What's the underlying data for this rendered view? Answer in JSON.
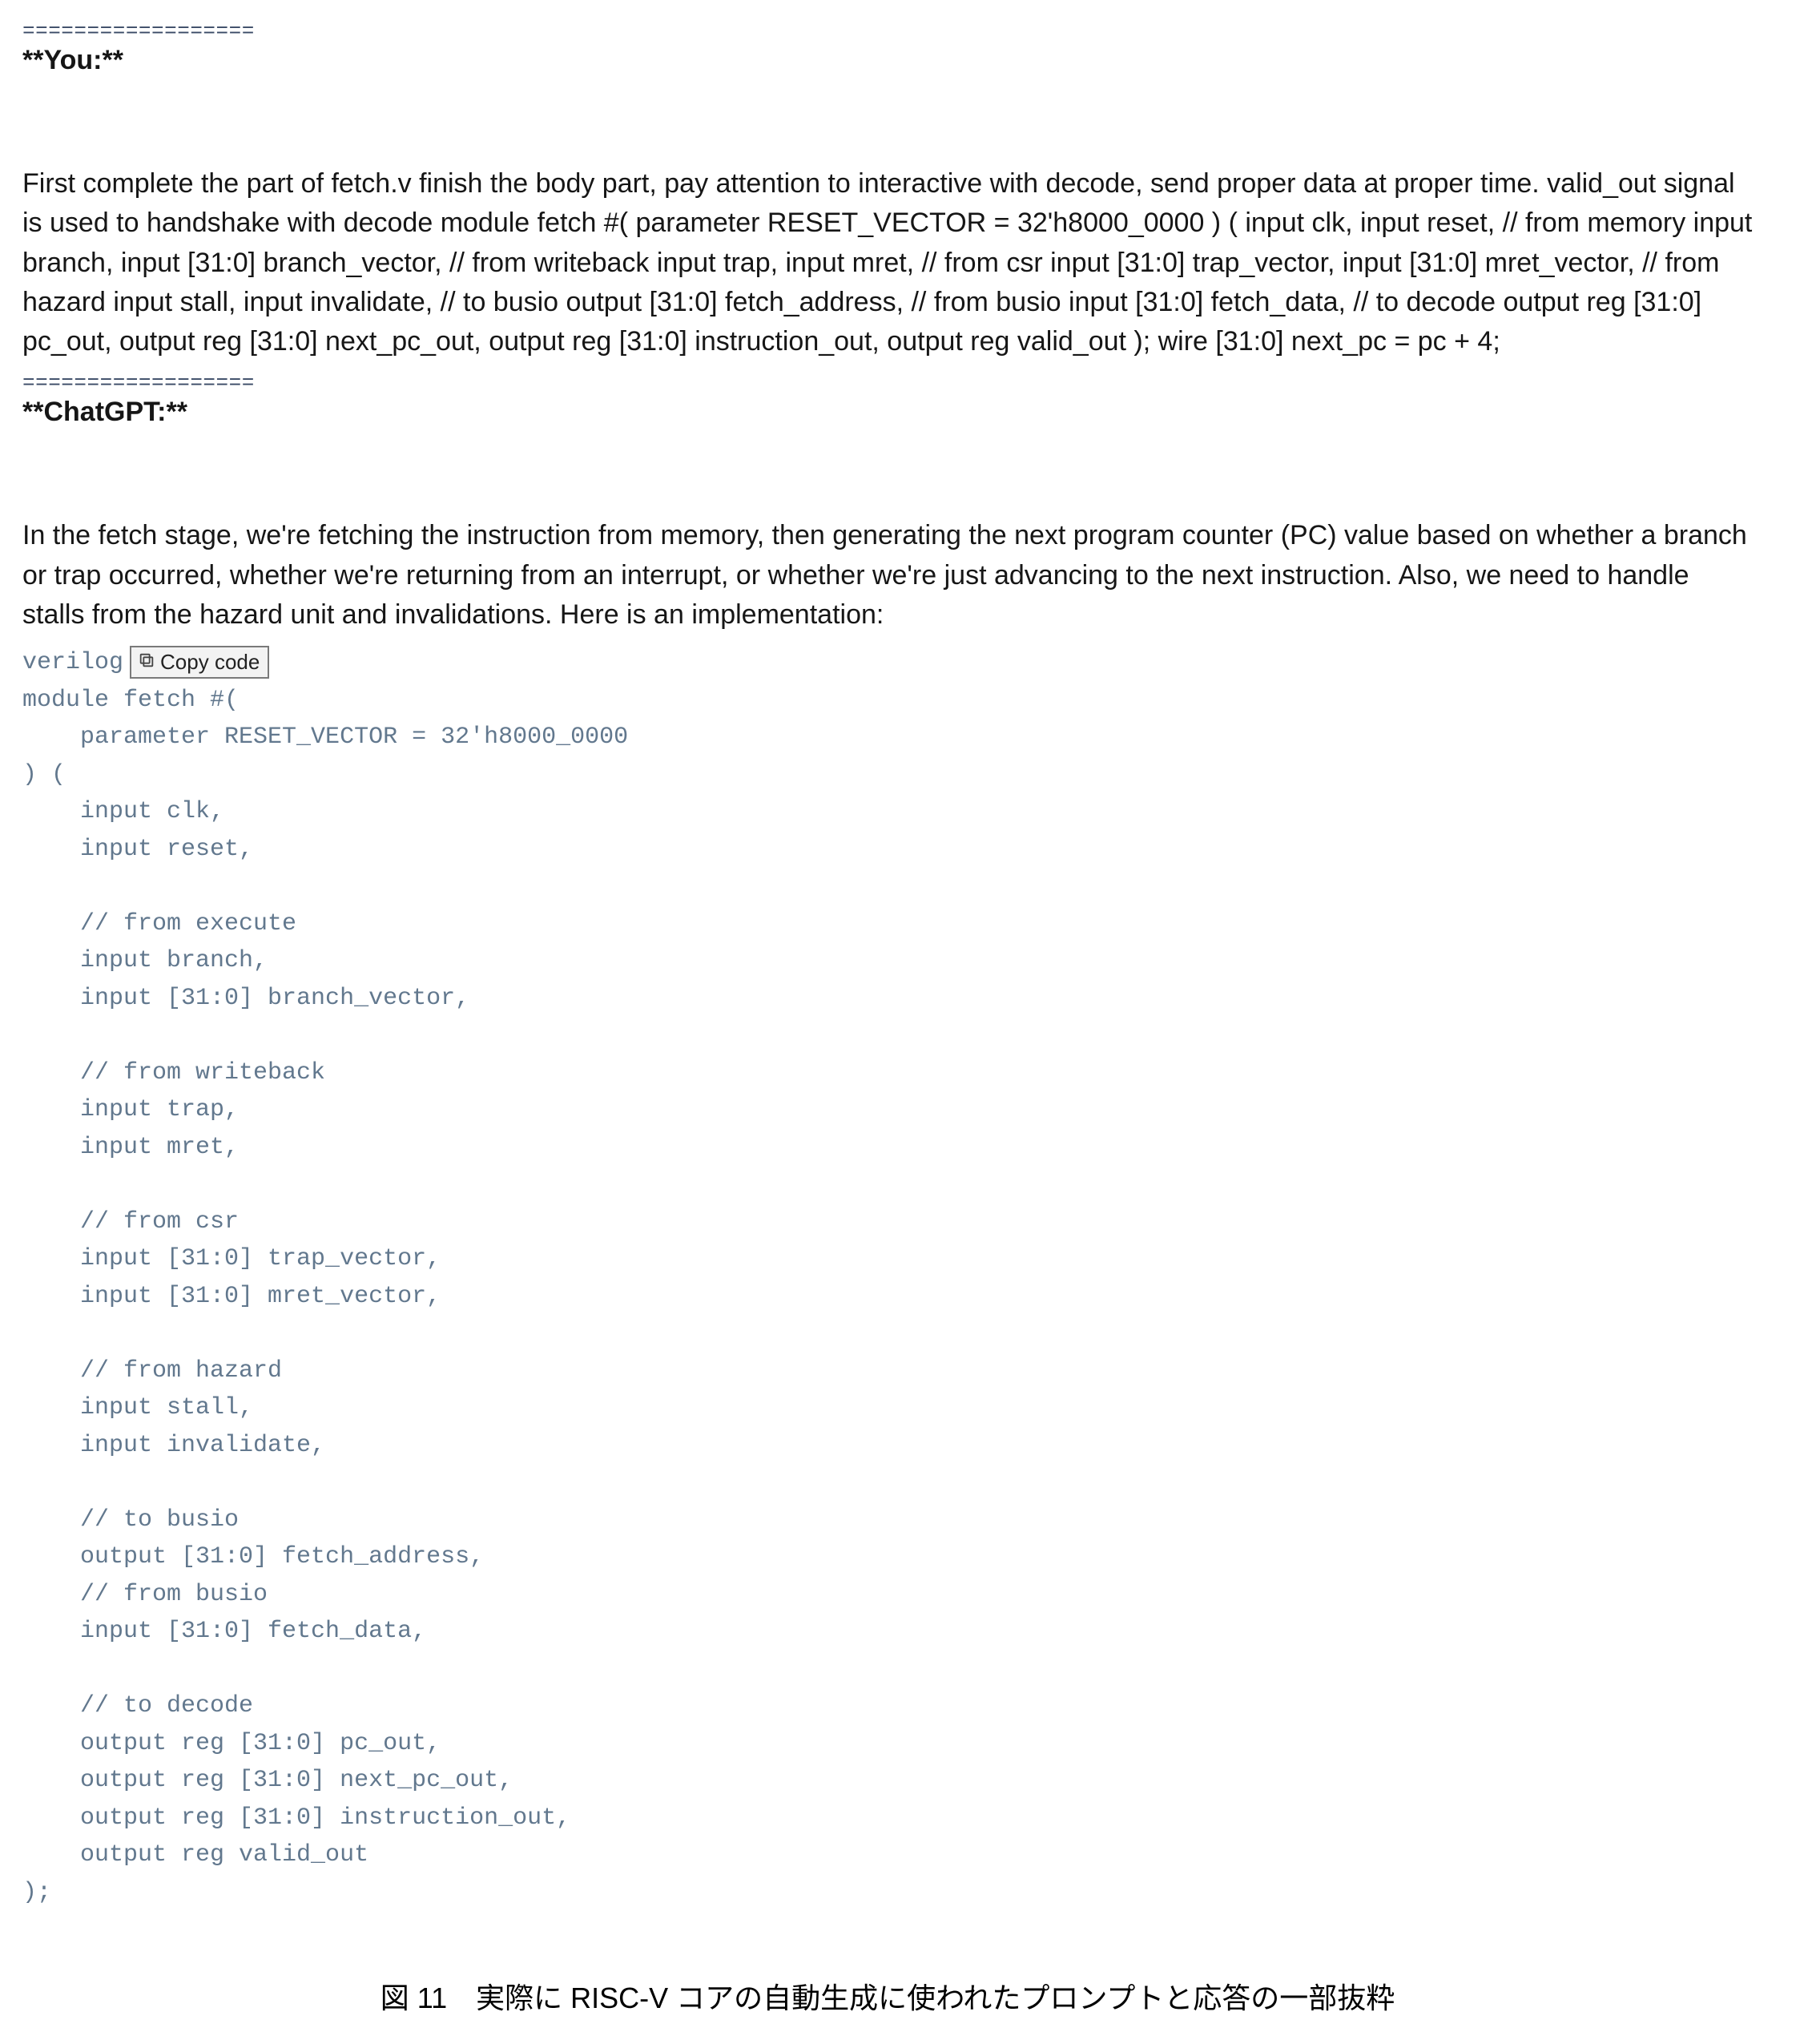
{
  "block1": {
    "separator": "==================",
    "speaker": "**You:**",
    "prose": "First complete the part of fetch.v finish the body part, pay attention to interactive with decode, send proper data at proper time. valid_out signal is used to handshake with decode module fetch #( parameter RESET_VECTOR = 32'h8000_0000 ) ( input clk, input reset, // from memory input branch, input [31:0] branch_vector, // from writeback input trap, input mret, // from csr input [31:0] trap_vector, input [31:0] mret_vector, // from hazard input stall, input invalidate, // to busio output [31:0] fetch_address, // from busio input [31:0] fetch_data, // to decode output reg [31:0] pc_out, output reg [31:0] next_pc_out, output reg [31:0] instruction_out, output reg valid_out ); wire [31:0] next_pc = pc + 4;"
  },
  "block2": {
    "separator": "==================",
    "speaker": "**ChatGPT:**",
    "prose": "In the fetch stage, we're fetching the instruction from memory, then generating the next program counter (PC) value based on whether a branch or trap occurred, whether we're returning from an interrupt, or whether we're just advancing to the next instruction. Also, we need to handle stalls from the hazard unit and invalidations. Here is an implementation:"
  },
  "code": {
    "lang_label": "verilog",
    "copy_label": "Copy code",
    "body": "module fetch #(\n    parameter RESET_VECTOR = 32'h8000_0000\n) (\n    input clk,\n    input reset,\n\n    // from execute\n    input branch,\n    input [31:0] branch_vector,\n\n    // from writeback\n    input trap,\n    input mret,\n\n    // from csr\n    input [31:0] trap_vector,\n    input [31:0] mret_vector,\n\n    // from hazard\n    input stall,\n    input invalidate,\n\n    // to busio\n    output [31:0] fetch_address,\n    // from busio\n    input [31:0] fetch_data,\n\n    // to decode\n    output reg [31:0] pc_out,\n    output reg [31:0] next_pc_out,\n    output reg [31:0] instruction_out,\n    output reg valid_out\n);"
  },
  "caption": "図 11　実際に RISC-V コアの自動生成に使われたプロンプトと応答の一部抜粋"
}
